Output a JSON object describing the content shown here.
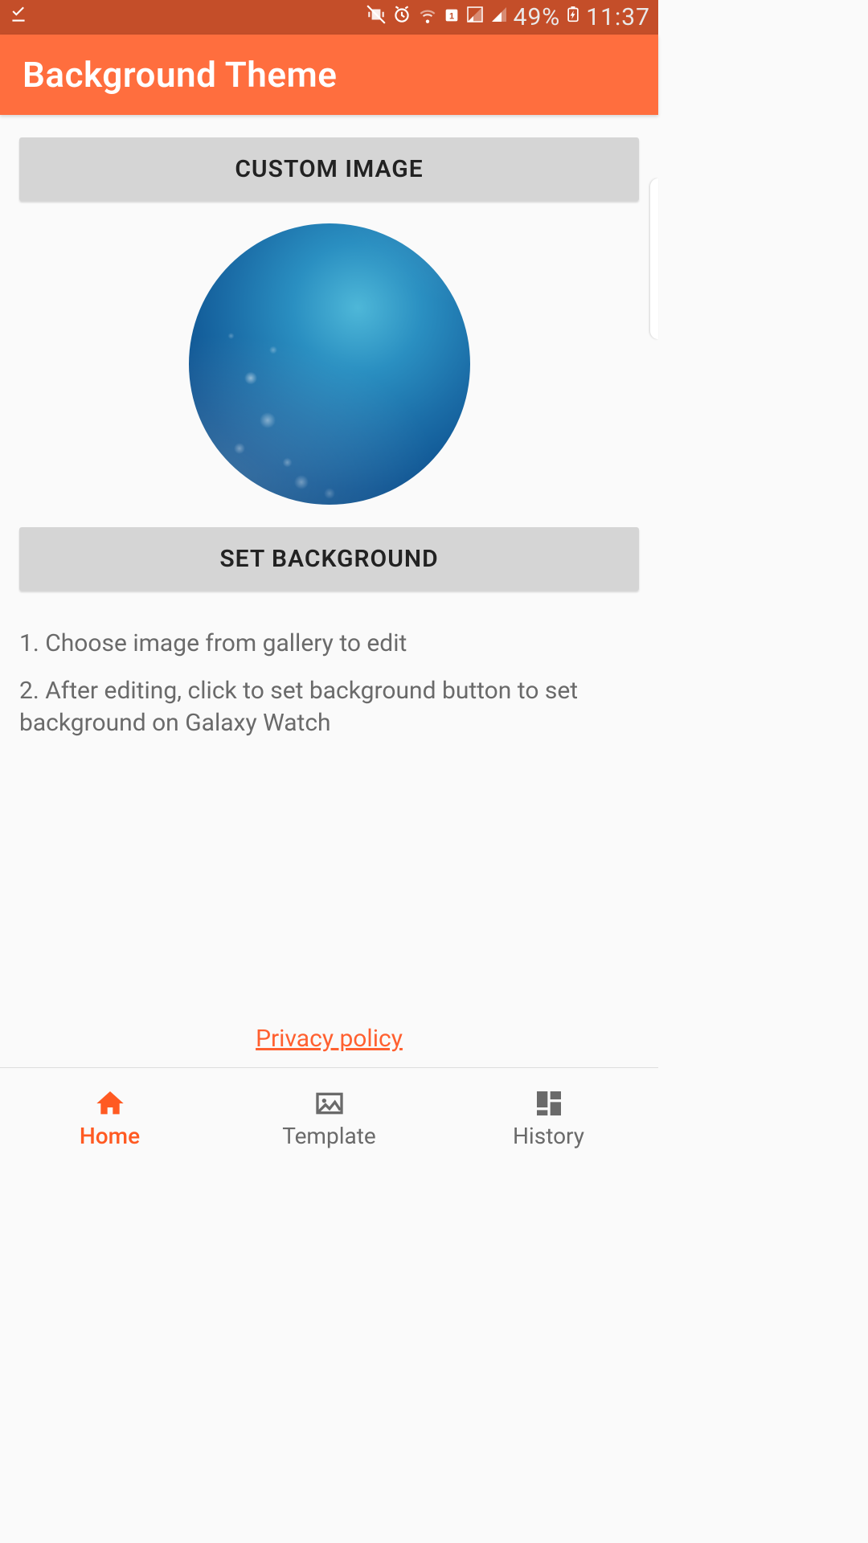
{
  "status": {
    "battery_pct": "49%",
    "time": "11:37"
  },
  "appbar": {
    "title": "Background Theme"
  },
  "buttons": {
    "custom_image": "CUSTOM IMAGE",
    "set_background": "SET BACKGROUND"
  },
  "instructions": {
    "line1": "1. Choose image from gallery to edit",
    "line2": "2. After editing, click to set background button to set background on Galaxy Watch"
  },
  "links": {
    "privacy": "Privacy policy"
  },
  "nav": {
    "home": "Home",
    "template": "Template",
    "history": "History"
  },
  "colors": {
    "accent": "#ff6e3e",
    "accent_dark": "#c44e29"
  }
}
